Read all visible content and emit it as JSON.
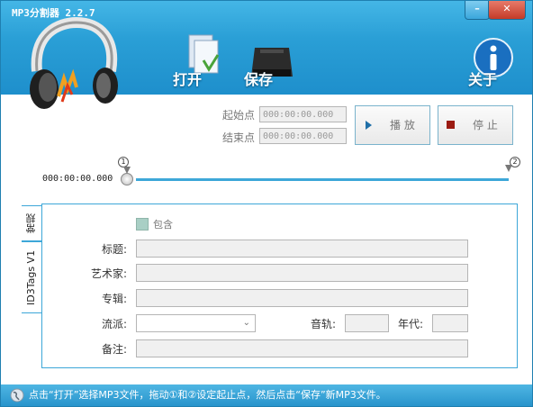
{
  "window": {
    "title": "MP3分割器 2.2.7",
    "minimize_label": "–",
    "close_label": "✕"
  },
  "toolbar": {
    "open_label": "打开",
    "save_label": "保存",
    "about_label": "关于"
  },
  "range": {
    "start_label": "起始点",
    "start_value": "000:00:00.000",
    "end_label": "结束点",
    "end_value": "000:00:00.000"
  },
  "controls": {
    "play_label": "播 放",
    "stop_label": "停 止"
  },
  "slider": {
    "marker1": "1",
    "marker2": "2",
    "time": "000:00:00.000"
  },
  "tabs": [
    {
      "label": "常规"
    },
    {
      "label": "ID3Tags V1"
    }
  ],
  "id3": {
    "include_label": "包含",
    "title_label": "标题:",
    "title_value": "",
    "artist_label": "艺术家:",
    "artist_value": "",
    "album_label": "专辑:",
    "album_value": "",
    "genre_label": "流派:",
    "genre_value": "",
    "track_label": "音轨:",
    "track_value": "",
    "year_label": "年代:",
    "year_value": "",
    "comment_label": "备注:",
    "comment_value": ""
  },
  "status": {
    "text": "点击“打开”选择MP3文件，拖动①和②设定起止点，然后点击“保存”新MP3文件。"
  },
  "colors": {
    "accent": "#2a9fd6",
    "stop": "#9b1b12",
    "play": "#1f6fa8"
  }
}
